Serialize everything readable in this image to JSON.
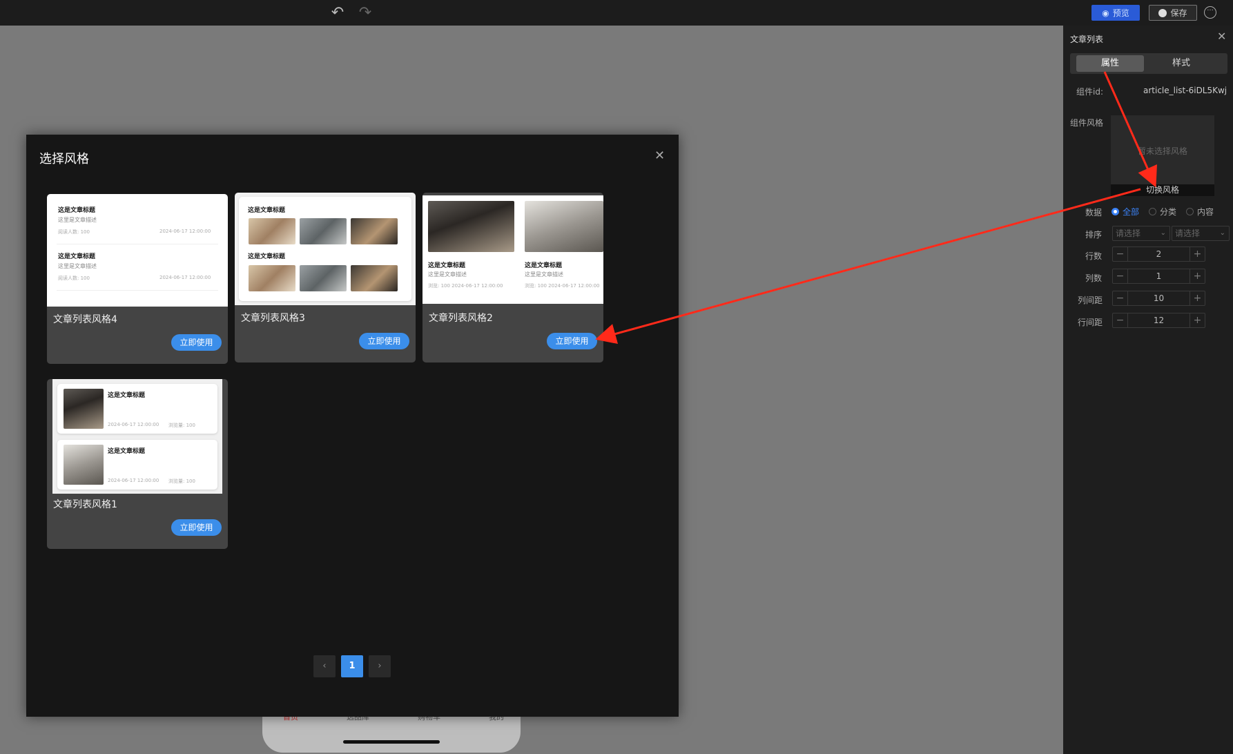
{
  "toolbar": {
    "undo_icon": "undo-icon",
    "redo_icon": "redo-icon",
    "preview_label": "预览",
    "save_label": "保存",
    "more_icon": "ellipsis-circle-icon"
  },
  "phone": {
    "tabs": [
      "首页",
      "选品库",
      "购物车",
      "我的"
    ]
  },
  "right_panel": {
    "title": "文章列表",
    "tabs": [
      {
        "label": "属性"
      },
      {
        "label": "样式"
      }
    ],
    "component_id_label": "组件id:",
    "component_id_value": "article_list-6iDL5Kwj",
    "style_label": "组件风格",
    "style_empty": "暂未选择风格",
    "switch_style": "切换风格",
    "data_label": "数据",
    "data_options": [
      {
        "label": "全部",
        "checked": true
      },
      {
        "label": "分类"
      },
      {
        "label": "内容"
      }
    ],
    "sort_label": "排序",
    "sort_placeholder_1": "请选择",
    "sort_placeholder_2": "请选择",
    "rows_label": "行数",
    "rows_value": "2",
    "cols_label": "列数",
    "cols_value": "1",
    "col_gap_label": "列间距",
    "col_gap_value": "10",
    "row_gap_label": "行间距",
    "row_gap_value": "12"
  },
  "modal": {
    "title": "选择风格",
    "use_label": "立即使用",
    "cards": [
      {
        "name": "文章列表风格4"
      },
      {
        "name": "文章列表风格3"
      },
      {
        "name": "文章列表风格2"
      },
      {
        "name": "文章列表风格1"
      }
    ],
    "thumb": {
      "article_title": "这是文章标题",
      "article_desc": "这里是文章描述",
      "read_count": "阅读人数: 100",
      "date": "2024-06-17 12:00:00",
      "views_date": "浏览: 100 2024-06-17 12:00:00",
      "views_short": "浏览量: 100"
    },
    "pagination": {
      "current": "1"
    }
  },
  "colors": {
    "accent": "#3b8eea",
    "annotation_arrow": "#ff2a1a"
  }
}
